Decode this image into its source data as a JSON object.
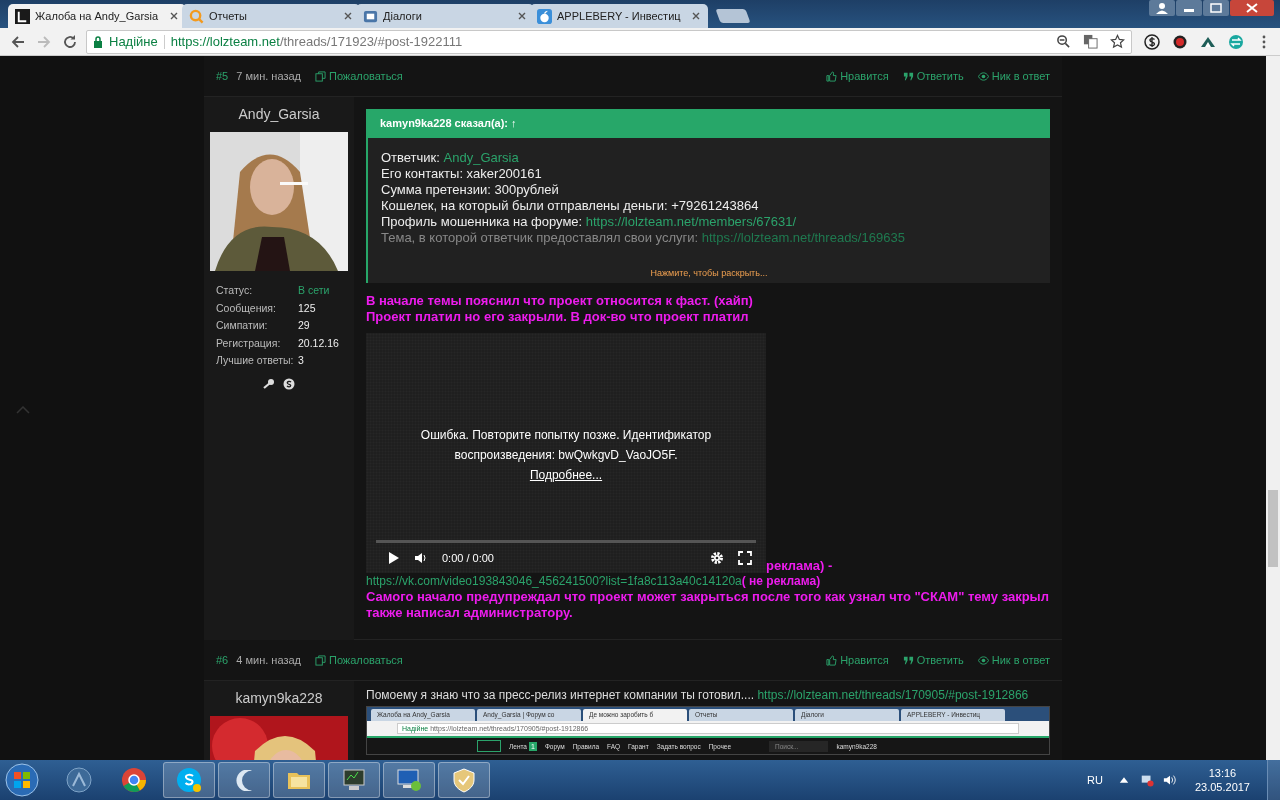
{
  "browser": {
    "tabs": [
      {
        "title": "Жалоба на Andy_Garsia",
        "kind": "lolz",
        "selected": true
      },
      {
        "title": "Отчеты",
        "kind": "search",
        "selected": false
      },
      {
        "title": "Діалоги",
        "kind": "dialog",
        "selected": false
      },
      {
        "title": "APPLEBERY - Инвестиц",
        "kind": "apple",
        "selected": false
      }
    ],
    "address": {
      "security": "Надійне",
      "host": "https://lolzteam.net",
      "path": "/threads/171923/#post-1922111"
    }
  },
  "posts": [
    {
      "number": "#5",
      "time": "7 мин. назад",
      "report": "Пожаловаться",
      "actions": [
        {
          "kind": "like",
          "label": "Нравится"
        },
        {
          "kind": "reply",
          "label": "Ответить"
        },
        {
          "kind": "nick",
          "label": "Ник в ответ"
        }
      ],
      "author": {
        "name": "Andy_Garsia",
        "stats": [
          {
            "label": "Статус:",
            "value": "В сети",
            "kind": "online"
          },
          {
            "label": "Сообщения:",
            "value": "125",
            "kind": "plain"
          },
          {
            "label": "Симпатии:",
            "value": "29",
            "kind": "plain"
          },
          {
            "label": "Регистрация:",
            "value": "20.12.16",
            "kind": "plain"
          },
          {
            "label": "Лучшие ответы:",
            "value": "3",
            "kind": "plain"
          }
        ],
        "contacts": [
          {
            "kind": "steam"
          },
          {
            "kind": "skype"
          }
        ]
      },
      "content": [
        {
          "kind": "quote",
          "author": "kamyn9ka228 сказал(а): ↑",
          "expand": "Нажмите, чтобы раскрыть...",
          "lines": [
            {
              "faded": false,
              "parts": [
                {
                  "kind": "plain",
                  "text": "Ответчик: "
                },
                {
                  "kind": "link",
                  "text": "Andy_Garsia"
                }
              ]
            },
            {
              "faded": false,
              "parts": [
                {
                  "kind": "plain",
                  "text": "Его контакты: xaker200161"
                }
              ]
            },
            {
              "faded": false,
              "parts": [
                {
                  "kind": "plain",
                  "text": "Сумма претензии: 300рублей"
                }
              ]
            },
            {
              "faded": false,
              "parts": [
                {
                  "kind": "plain",
                  "text": "Кошелек, на который были отправлены деньги: +79261243864"
                }
              ]
            },
            {
              "faded": false,
              "parts": [
                {
                  "kind": "plain",
                  "text": "Профиль мошенника на форуме: "
                },
                {
                  "kind": "link",
                  "text": "https://lolzteam.net/members/67631/"
                }
              ]
            },
            {
              "faded": true,
              "parts": [
                {
                  "kind": "plain",
                  "text": "Тема, в которой ответчик предоставлял свои услуги: "
                },
                {
                  "kind": "link",
                  "text": "https://lolzteam.net/threads/169635"
                }
              ]
            }
          ]
        },
        {
          "kind": "highlight",
          "lines": [
            "В начале темы пояснил что проект относится к фаст. (хайп)",
            "Проект платил но его закрыли. В док-во что проект платил"
          ]
        },
        {
          "kind": "video",
          "error": [
            "Ошибка. Повторите попытку позже. Идентификатор",
            "воспроизведения: bwQwkgvD_VaoJO5F."
          ],
          "more": "Подробнее...",
          "time": "0:00 / 0:00",
          "level": 0,
          "trailing": "реклама) -"
        },
        {
          "kind": "mixed",
          "parts": [
            {
              "kind": "link",
              "text": "https://vk.com/video193843046_456241500?list=1fa8c113a40c14120a"
            },
            {
              "kind": "highlight",
              "text": "( не реклама)"
            }
          ]
        },
        {
          "kind": "highlight",
          "lines": [
            "Самого начало предупреждал что проект может закрыться после того как узнал что \"СКАМ\" тему закрыл также написал администратору."
          ]
        }
      ]
    },
    {
      "number": "#6",
      "time": "4 мин. назад",
      "report": "Пожаловаться",
      "actions": [
        {
          "kind": "like",
          "label": "Нравится"
        },
        {
          "kind": "reply",
          "label": "Ответить"
        },
        {
          "kind": "nick",
          "label": "Ник в ответ"
        }
      ],
      "author": {
        "name": "kamyn9ka228"
      },
      "content": [
        {
          "kind": "mixed",
          "parts": [
            {
              "kind": "plain",
              "text": "Помоему я знаю что за пресс-релиз интернет компании ты готовил.... "
            },
            {
              "kind": "link",
              "text": "https://lolzteam.net/threads/170905/#post-1912866"
            }
          ]
        },
        {
          "kind": "screenshot",
          "tabs": [
            {
              "title": "Жалоба на Andy_Garsia",
              "selected": false
            },
            {
              "title": "Andy_Garsia | Форум со",
              "selected": false
            },
            {
              "title": "Де можно заробить б",
              "selected": true
            },
            {
              "title": "Отчеты",
              "selected": false
            },
            {
              "title": "Діалоги",
              "selected": false
            },
            {
              "title": "APPLEBERY - Инвестиц",
              "selected": false
            }
          ],
          "security": "Надійне",
          "url": "https://lolzteam.net/threads/170905/#post-1912866",
          "nav": [
            "Лента",
            "Форум",
            "Правила",
            "FAQ",
            "Гарант",
            "Задать вопрос",
            "Прочее"
          ],
          "badge": "1",
          "search": "Поиск...",
          "user": "kamyn9ka228"
        }
      ]
    }
  ],
  "taskbar": {
    "items": [
      {
        "kind": "circle-app",
        "open": false
      },
      {
        "kind": "chrome",
        "open": false
      },
      {
        "kind": "skype",
        "open": true
      },
      {
        "kind": "crescent",
        "open": true
      },
      {
        "kind": "folder",
        "open": true
      },
      {
        "kind": "monitor",
        "open": true
      },
      {
        "kind": "remote",
        "open": true
      },
      {
        "kind": "shield",
        "open": true
      }
    ],
    "language": "RU",
    "time": "13:16",
    "date": "23.05.2017"
  }
}
